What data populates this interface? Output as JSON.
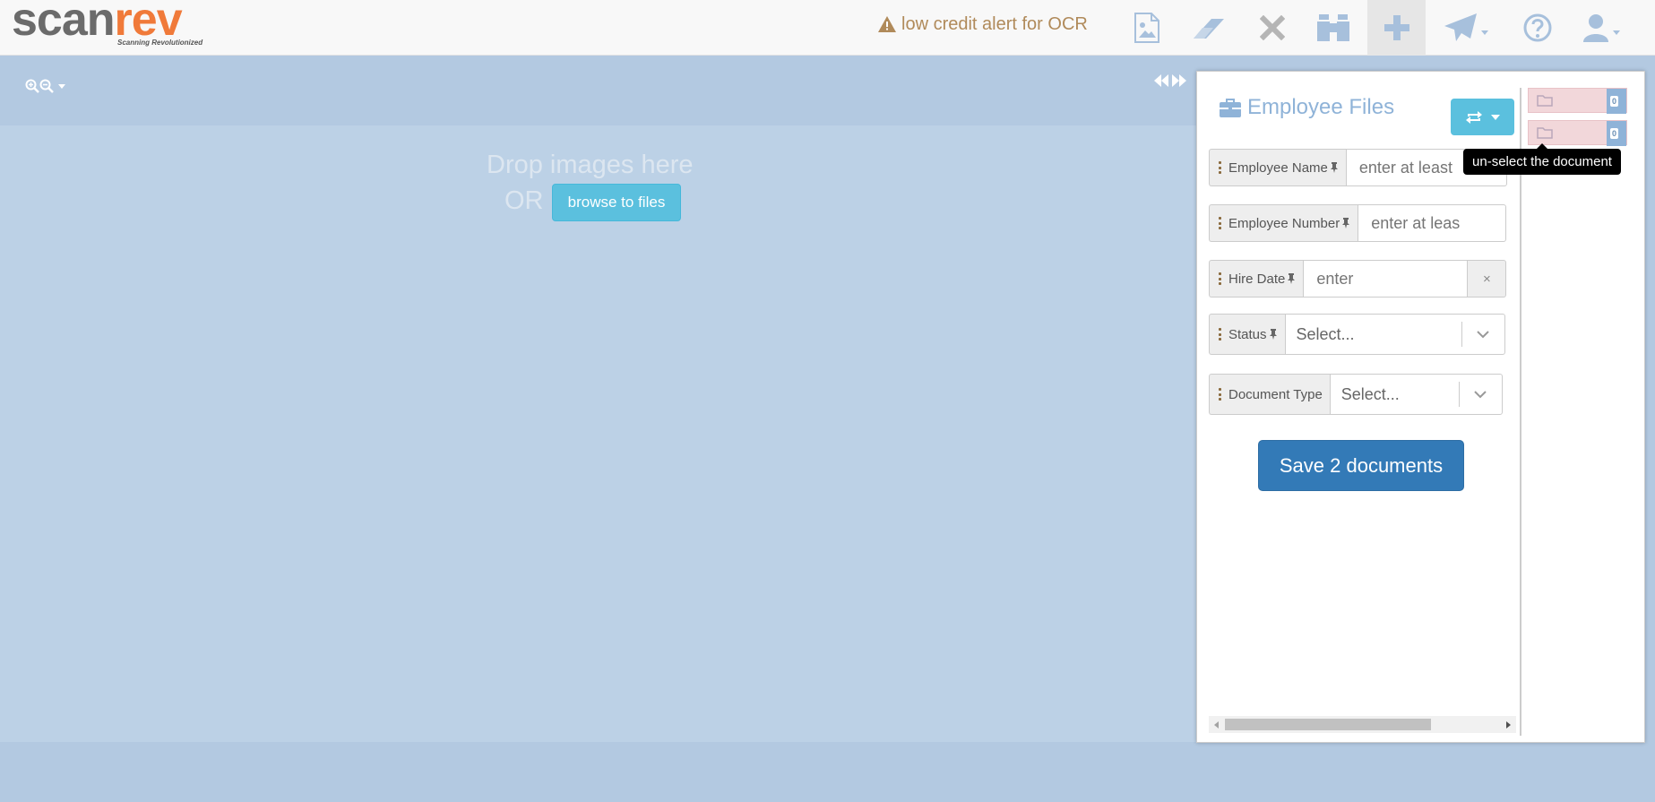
{
  "brand": {
    "name_part1": "scan",
    "name_part2": "rev",
    "tagline": "Scanning Revolutionized",
    "colors": {
      "gray": "#6b6b6b",
      "orange": "#f07a3a"
    }
  },
  "header": {
    "alert_text": "low credit alert for OCR",
    "alert_color": "#b08a5a",
    "icons": [
      "image-icon",
      "eraser-icon",
      "close-icon",
      "binoculars-icon",
      "plus-icon",
      "send-icon",
      "help-icon",
      "user-icon"
    ]
  },
  "dropzone": {
    "drop_text": "Drop images here",
    "or_text": "OR",
    "browse_label": "browse to files"
  },
  "panel": {
    "title": "Employee Files",
    "fields": [
      {
        "label": "Employee Name",
        "placeholder": "enter at least"
      },
      {
        "label": "Employee Number",
        "placeholder": "enter at leas"
      },
      {
        "label": "Hire Date",
        "placeholder": "enter",
        "clear": "×"
      },
      {
        "label": "Status",
        "value": "Select..."
      },
      {
        "label": "Document Type",
        "value": "Select..."
      }
    ],
    "save_label": "Save 2 documents",
    "accent": "#337ab7"
  },
  "documents": {
    "thumbs": [
      {
        "badge": "0"
      },
      {
        "badge": "0"
      }
    ],
    "tooltip": "un-select the document"
  }
}
